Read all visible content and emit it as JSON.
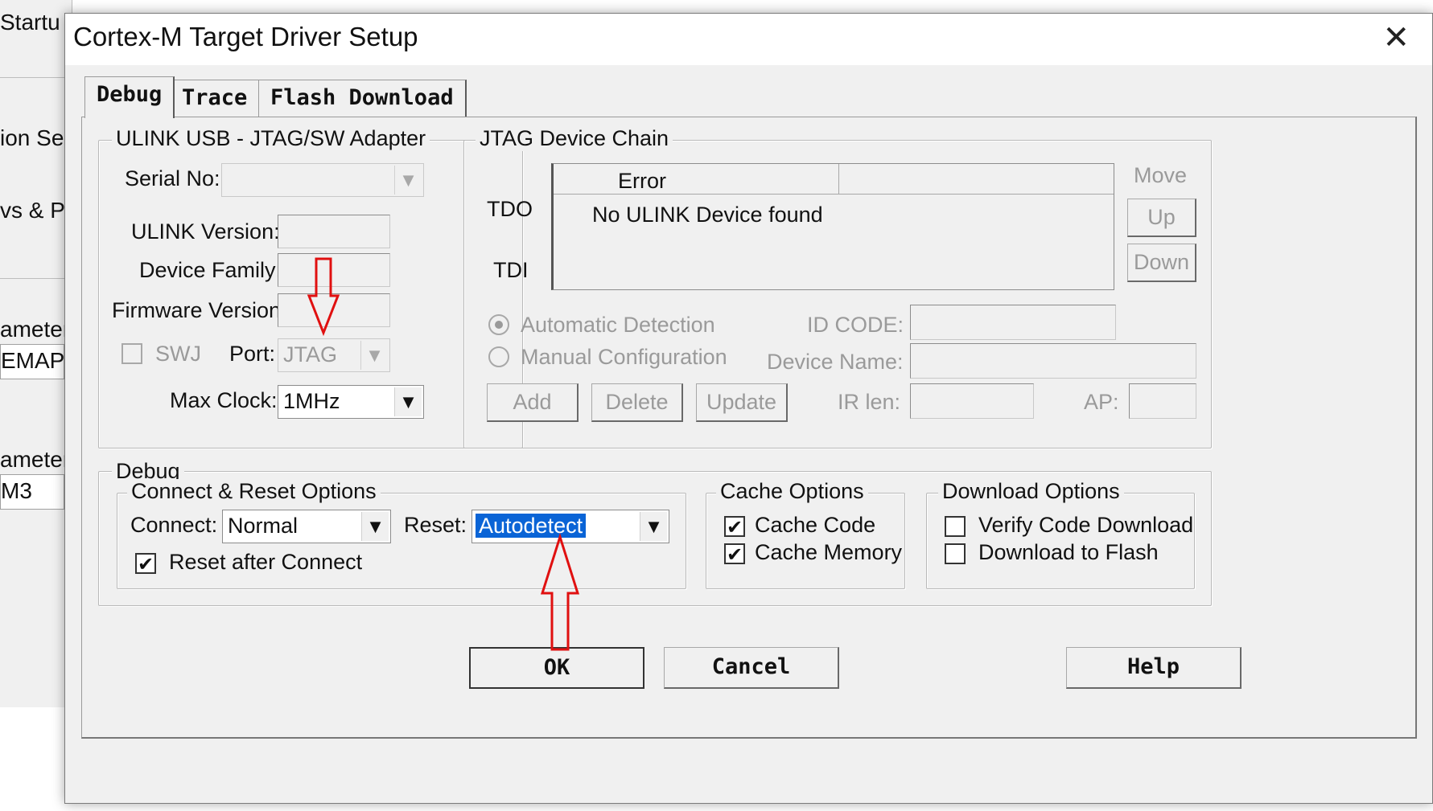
{
  "background": {
    "texts": [
      "Startu",
      "ion Se",
      "vs & Pe",
      "ameter:",
      "EMAP",
      "ameter:",
      "M3"
    ]
  },
  "dialog": {
    "title": "Cortex-M Target Driver Setup",
    "close_glyph": "✕",
    "tabs": [
      {
        "label": "Debug",
        "active": true
      },
      {
        "label": "Trace",
        "active": false
      },
      {
        "label": "Flash Download",
        "active": false
      }
    ]
  },
  "adapter": {
    "legend": "ULINK USB - JTAG/SW Adapter",
    "serial_label": "Serial No:",
    "serial_value": "",
    "version_label": "ULINK Version:",
    "family_label": "Device Family:",
    "firmware_label": "Firmware Version:",
    "swj_label": "SWJ",
    "port_label": "Port:",
    "port_value": "JTAG",
    "clock_label": "Max Clock:",
    "clock_value": "1MHz"
  },
  "jtag": {
    "legend": "JTAG Device Chain",
    "tdo": "TDO",
    "tdi": "TDI",
    "column_header": "Error",
    "message": "No ULINK Device found",
    "move_label": "Move",
    "up_button": "Up",
    "down_button": "Down",
    "auto_detection": "Automatic Detection",
    "manual_config": "Manual Configuration",
    "id_code_label": "ID CODE:",
    "device_name_label": "Device Name:",
    "add_button": "Add",
    "delete_button": "Delete",
    "update_button": "Update",
    "ir_len_label": "IR len:",
    "ap_label": "AP:"
  },
  "debug": {
    "legend": "Debug",
    "connect_reset": {
      "legend": "Connect & Reset Options",
      "connect_label": "Connect:",
      "connect_value": "Normal",
      "reset_label": "Reset:",
      "reset_value": "Autodetect",
      "reset_after_connect": "Reset after Connect",
      "reset_after_connect_checked": true
    },
    "cache": {
      "legend": "Cache Options",
      "cache_code": "Cache Code",
      "cache_code_checked": true,
      "cache_memory": "Cache Memory",
      "cache_memory_checked": true
    },
    "download": {
      "legend": "Download Options",
      "verify": "Verify Code Download",
      "verify_checked": false,
      "to_flash": "Download to Flash",
      "to_flash_checked": false
    }
  },
  "footer": {
    "ok": "OK",
    "cancel": "Cancel",
    "help": "Help"
  },
  "colors": {
    "annotation_arrow": "#e01010",
    "selection": "#0a64d6"
  },
  "check_glyph": "✔",
  "combo_arrow_glyph": "▼"
}
